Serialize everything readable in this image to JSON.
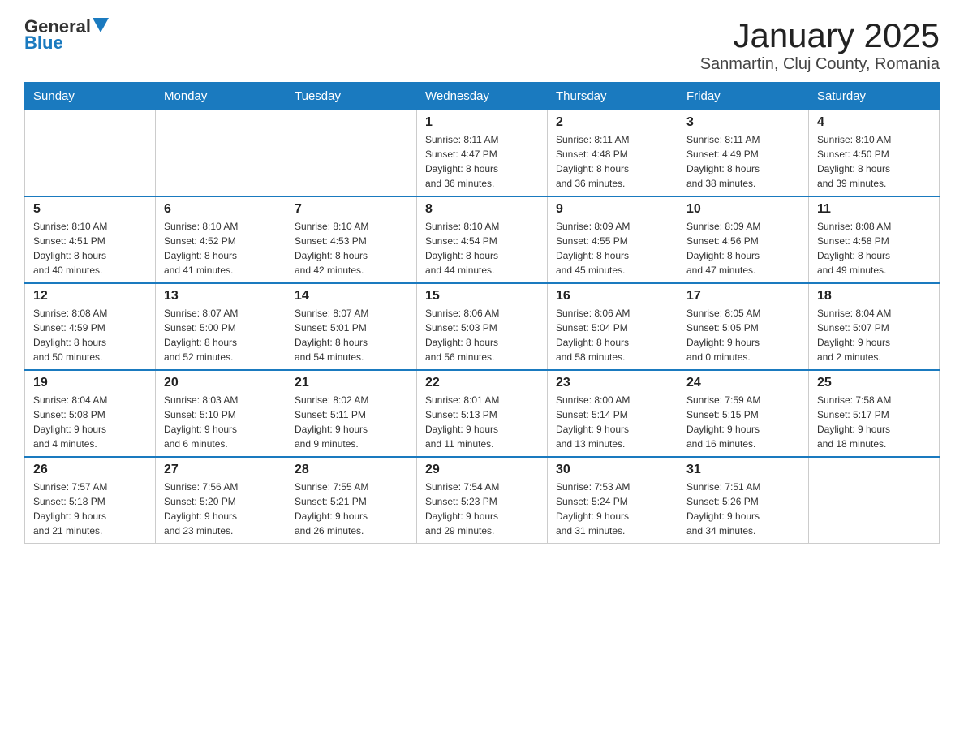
{
  "header": {
    "logo_general": "General",
    "logo_blue": "Blue",
    "title": "January 2025",
    "subtitle": "Sanmartin, Cluj County, Romania"
  },
  "days_of_week": [
    "Sunday",
    "Monday",
    "Tuesday",
    "Wednesday",
    "Thursday",
    "Friday",
    "Saturday"
  ],
  "weeks": [
    [
      {
        "day": "",
        "info": ""
      },
      {
        "day": "",
        "info": ""
      },
      {
        "day": "",
        "info": ""
      },
      {
        "day": "1",
        "info": "Sunrise: 8:11 AM\nSunset: 4:47 PM\nDaylight: 8 hours\nand 36 minutes."
      },
      {
        "day": "2",
        "info": "Sunrise: 8:11 AM\nSunset: 4:48 PM\nDaylight: 8 hours\nand 36 minutes."
      },
      {
        "day": "3",
        "info": "Sunrise: 8:11 AM\nSunset: 4:49 PM\nDaylight: 8 hours\nand 38 minutes."
      },
      {
        "day": "4",
        "info": "Sunrise: 8:10 AM\nSunset: 4:50 PM\nDaylight: 8 hours\nand 39 minutes."
      }
    ],
    [
      {
        "day": "5",
        "info": "Sunrise: 8:10 AM\nSunset: 4:51 PM\nDaylight: 8 hours\nand 40 minutes."
      },
      {
        "day": "6",
        "info": "Sunrise: 8:10 AM\nSunset: 4:52 PM\nDaylight: 8 hours\nand 41 minutes."
      },
      {
        "day": "7",
        "info": "Sunrise: 8:10 AM\nSunset: 4:53 PM\nDaylight: 8 hours\nand 42 minutes."
      },
      {
        "day": "8",
        "info": "Sunrise: 8:10 AM\nSunset: 4:54 PM\nDaylight: 8 hours\nand 44 minutes."
      },
      {
        "day": "9",
        "info": "Sunrise: 8:09 AM\nSunset: 4:55 PM\nDaylight: 8 hours\nand 45 minutes."
      },
      {
        "day": "10",
        "info": "Sunrise: 8:09 AM\nSunset: 4:56 PM\nDaylight: 8 hours\nand 47 minutes."
      },
      {
        "day": "11",
        "info": "Sunrise: 8:08 AM\nSunset: 4:58 PM\nDaylight: 8 hours\nand 49 minutes."
      }
    ],
    [
      {
        "day": "12",
        "info": "Sunrise: 8:08 AM\nSunset: 4:59 PM\nDaylight: 8 hours\nand 50 minutes."
      },
      {
        "day": "13",
        "info": "Sunrise: 8:07 AM\nSunset: 5:00 PM\nDaylight: 8 hours\nand 52 minutes."
      },
      {
        "day": "14",
        "info": "Sunrise: 8:07 AM\nSunset: 5:01 PM\nDaylight: 8 hours\nand 54 minutes."
      },
      {
        "day": "15",
        "info": "Sunrise: 8:06 AM\nSunset: 5:03 PM\nDaylight: 8 hours\nand 56 minutes."
      },
      {
        "day": "16",
        "info": "Sunrise: 8:06 AM\nSunset: 5:04 PM\nDaylight: 8 hours\nand 58 minutes."
      },
      {
        "day": "17",
        "info": "Sunrise: 8:05 AM\nSunset: 5:05 PM\nDaylight: 9 hours\nand 0 minutes."
      },
      {
        "day": "18",
        "info": "Sunrise: 8:04 AM\nSunset: 5:07 PM\nDaylight: 9 hours\nand 2 minutes."
      }
    ],
    [
      {
        "day": "19",
        "info": "Sunrise: 8:04 AM\nSunset: 5:08 PM\nDaylight: 9 hours\nand 4 minutes."
      },
      {
        "day": "20",
        "info": "Sunrise: 8:03 AM\nSunset: 5:10 PM\nDaylight: 9 hours\nand 6 minutes."
      },
      {
        "day": "21",
        "info": "Sunrise: 8:02 AM\nSunset: 5:11 PM\nDaylight: 9 hours\nand 9 minutes."
      },
      {
        "day": "22",
        "info": "Sunrise: 8:01 AM\nSunset: 5:13 PM\nDaylight: 9 hours\nand 11 minutes."
      },
      {
        "day": "23",
        "info": "Sunrise: 8:00 AM\nSunset: 5:14 PM\nDaylight: 9 hours\nand 13 minutes."
      },
      {
        "day": "24",
        "info": "Sunrise: 7:59 AM\nSunset: 5:15 PM\nDaylight: 9 hours\nand 16 minutes."
      },
      {
        "day": "25",
        "info": "Sunrise: 7:58 AM\nSunset: 5:17 PM\nDaylight: 9 hours\nand 18 minutes."
      }
    ],
    [
      {
        "day": "26",
        "info": "Sunrise: 7:57 AM\nSunset: 5:18 PM\nDaylight: 9 hours\nand 21 minutes."
      },
      {
        "day": "27",
        "info": "Sunrise: 7:56 AM\nSunset: 5:20 PM\nDaylight: 9 hours\nand 23 minutes."
      },
      {
        "day": "28",
        "info": "Sunrise: 7:55 AM\nSunset: 5:21 PM\nDaylight: 9 hours\nand 26 minutes."
      },
      {
        "day": "29",
        "info": "Sunrise: 7:54 AM\nSunset: 5:23 PM\nDaylight: 9 hours\nand 29 minutes."
      },
      {
        "day": "30",
        "info": "Sunrise: 7:53 AM\nSunset: 5:24 PM\nDaylight: 9 hours\nand 31 minutes."
      },
      {
        "day": "31",
        "info": "Sunrise: 7:51 AM\nSunset: 5:26 PM\nDaylight: 9 hours\nand 34 minutes."
      },
      {
        "day": "",
        "info": ""
      }
    ]
  ]
}
